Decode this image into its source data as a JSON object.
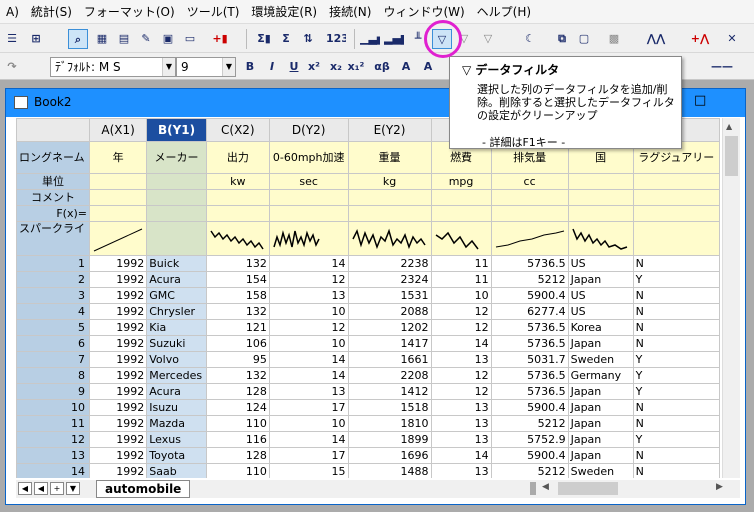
{
  "menu": [
    "A)",
    "統計(S)",
    "フォーマット(O)",
    "ツール(T)",
    "環境設定(R)",
    "接続(N)",
    "ウィンドウ(W)",
    "ヘルプ(H)"
  ],
  "toolbar2": {
    "font": "ﾃﾞﾌｫﾙﾄ: M S",
    "size": "9"
  },
  "window": {
    "title": "Book2"
  },
  "sheet": {
    "tab": "automobile"
  },
  "tooltip": {
    "title": "データフィルタ",
    "body": "選択した列のデータフィルタを追加/削除。削除すると選択したデータフィルタの設定がクリーンアップ",
    "more": "- 詳細はF1キー -"
  },
  "row_labels": {
    "longname": "ロングネーム",
    "units": "単位",
    "comments": "コメント",
    "fx": "F(x)=",
    "sparkline": "スパークライ"
  },
  "columns": [
    {
      "header": "A(X1)",
      "longname": "年",
      "units": ""
    },
    {
      "header": "B(Y1)",
      "longname": "メーカー",
      "units": ""
    },
    {
      "header": "C(X2)",
      "longname": "出力",
      "units": "kw"
    },
    {
      "header": "D(Y2)",
      "longname": "0-60mph加速",
      "units": "sec"
    },
    {
      "header": "E(Y2)",
      "longname": "重量",
      "units": "kg"
    },
    {
      "header": "F(Y",
      "longname": "燃費",
      "units": "mpg"
    },
    {
      "header": "",
      "longname": "排気量",
      "units": "cc"
    },
    {
      "header": "",
      "longname": "国",
      "units": ""
    },
    {
      "header": "",
      "longname": "ラグジュアリー",
      "units": ""
    }
  ],
  "rows": [
    [
      "1",
      "1992",
      "Buick",
      "132",
      "14",
      "2238",
      "11",
      "5736.5",
      "US",
      "N"
    ],
    [
      "2",
      "1992",
      "Acura",
      "154",
      "12",
      "2324",
      "11",
      "5212",
      "Japan",
      "Y"
    ],
    [
      "3",
      "1992",
      "GMC",
      "158",
      "13",
      "1531",
      "10",
      "5900.4",
      "US",
      "N"
    ],
    [
      "4",
      "1992",
      "Chrysler",
      "132",
      "10",
      "2088",
      "12",
      "6277.4",
      "US",
      "N"
    ],
    [
      "5",
      "1992",
      "Kia",
      "121",
      "12",
      "1202",
      "12",
      "5736.5",
      "Korea",
      "N"
    ],
    [
      "6",
      "1992",
      "Suzuki",
      "106",
      "10",
      "1417",
      "14",
      "5736.5",
      "Japan",
      "N"
    ],
    [
      "7",
      "1992",
      "Volvo",
      "95",
      "14",
      "1661",
      "13",
      "5031.7",
      "Sweden",
      "Y"
    ],
    [
      "8",
      "1992",
      "Mercedes",
      "132",
      "14",
      "2208",
      "12",
      "5736.5",
      "Germany",
      "Y"
    ],
    [
      "9",
      "1992",
      "Acura",
      "128",
      "13",
      "1412",
      "12",
      "5736.5",
      "Japan",
      "Y"
    ],
    [
      "10",
      "1992",
      "Isuzu",
      "124",
      "17",
      "1518",
      "13",
      "5900.4",
      "Japan",
      "N"
    ],
    [
      "11",
      "1992",
      "Mazda",
      "110",
      "10",
      "1810",
      "13",
      "5212",
      "Japan",
      "N"
    ],
    [
      "12",
      "1992",
      "Lexus",
      "116",
      "14",
      "1899",
      "13",
      "5752.9",
      "Japan",
      "Y"
    ],
    [
      "13",
      "1992",
      "Toyota",
      "128",
      "17",
      "1696",
      "14",
      "5900.4",
      "Japan",
      "N"
    ],
    [
      "14",
      "1992",
      "Saab",
      "110",
      "15",
      "1488",
      "13",
      "5212",
      "Sweden",
      "N"
    ]
  ],
  "colors": {
    "title_bar": "#1e90ff",
    "selected_header": "#1c4ea0",
    "meta_bg": "#fffccc",
    "row_header": "#b8cfe4",
    "highlight_ring": "#e020d0"
  }
}
